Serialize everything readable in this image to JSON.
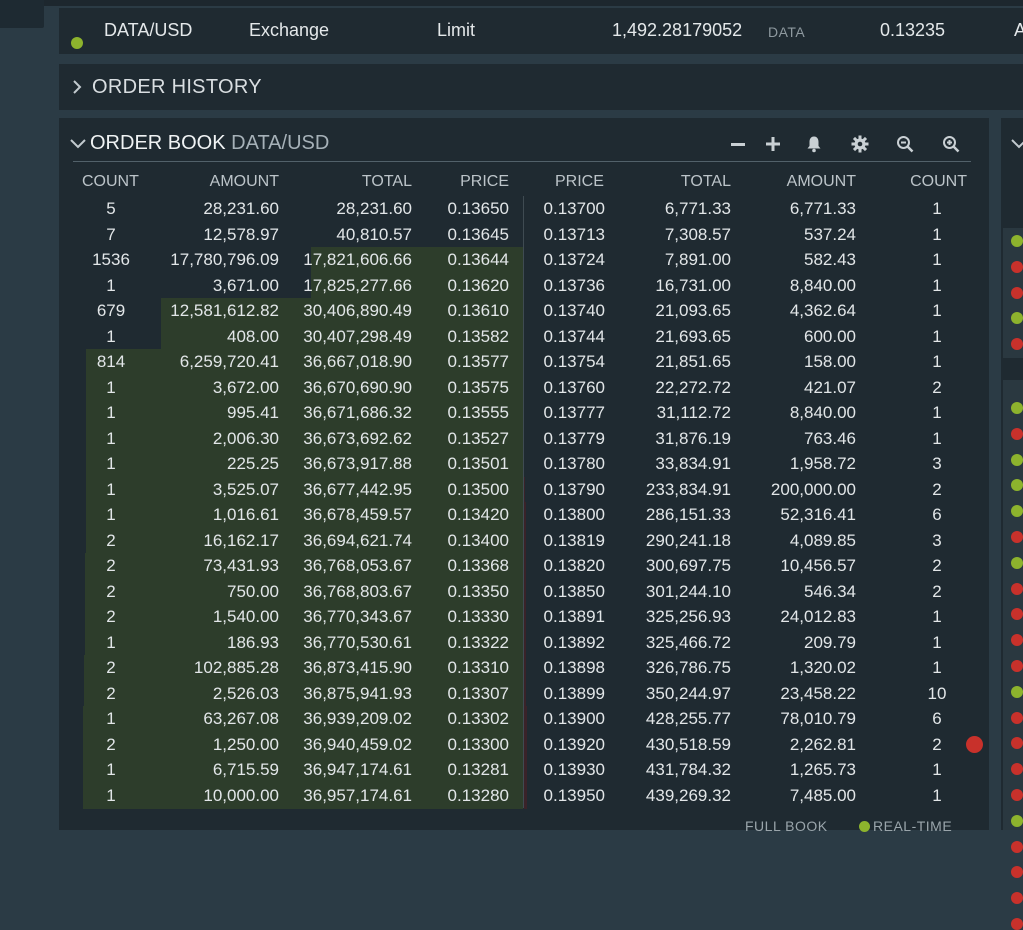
{
  "active_order": {
    "pair": "DATA/USD",
    "type": "Exchange",
    "order_type": "Limit",
    "amount": "1,492.28179052",
    "currency": "DATA",
    "price": "0.13235",
    "trailing": "A"
  },
  "order_history": {
    "title": "ORDER HISTORY"
  },
  "order_book": {
    "title": "ORDER BOOK",
    "pair": "DATA/USD",
    "tools": [
      "minus-icon",
      "plus-icon",
      "bell-icon",
      "gear-icon",
      "zoom-out-icon",
      "zoom-in-icon"
    ],
    "bid_headers": [
      "COUNT",
      "AMOUNT",
      "TOTAL",
      "PRICE"
    ],
    "ask_headers": [
      "PRICE",
      "TOTAL",
      "AMOUNT",
      "COUNT"
    ],
    "bids": [
      {
        "count": "5",
        "amount": "28,231.60",
        "total": "28,231.60",
        "price": "0.13650"
      },
      {
        "count": "7",
        "amount": "12,578.97",
        "total": "40,810.57",
        "price": "0.13645"
      },
      {
        "count": "1536",
        "amount": "17,780,796.09",
        "total": "17,821,606.66",
        "price": "0.13644"
      },
      {
        "count": "1",
        "amount": "3,671.00",
        "total": "17,825,277.66",
        "price": "0.13620"
      },
      {
        "count": "679",
        "amount": "12,581,612.82",
        "total": "30,406,890.49",
        "price": "0.13610"
      },
      {
        "count": "1",
        "amount": "408.00",
        "total": "30,407,298.49",
        "price": "0.13582"
      },
      {
        "count": "814",
        "amount": "6,259,720.41",
        "total": "36,667,018.90",
        "price": "0.13577"
      },
      {
        "count": "1",
        "amount": "3,672.00",
        "total": "36,670,690.90",
        "price": "0.13575"
      },
      {
        "count": "1",
        "amount": "995.41",
        "total": "36,671,686.32",
        "price": "0.13555"
      },
      {
        "count": "1",
        "amount": "2,006.30",
        "total": "36,673,692.62",
        "price": "0.13527"
      },
      {
        "count": "1",
        "amount": "225.25",
        "total": "36,673,917.88",
        "price": "0.13501"
      },
      {
        "count": "1",
        "amount": "3,525.07",
        "total": "36,677,442.95",
        "price": "0.13500"
      },
      {
        "count": "1",
        "amount": "1,016.61",
        "total": "36,678,459.57",
        "price": "0.13420"
      },
      {
        "count": "2",
        "amount": "16,162.17",
        "total": "36,694,621.74",
        "price": "0.13400"
      },
      {
        "count": "2",
        "amount": "73,431.93",
        "total": "36,768,053.67",
        "price": "0.13368"
      },
      {
        "count": "2",
        "amount": "750.00",
        "total": "36,768,803.67",
        "price": "0.13350"
      },
      {
        "count": "2",
        "amount": "1,540.00",
        "total": "36,770,343.67",
        "price": "0.13330"
      },
      {
        "count": "1",
        "amount": "186.93",
        "total": "36,770,530.61",
        "price": "0.13322"
      },
      {
        "count": "2",
        "amount": "102,885.28",
        "total": "36,873,415.90",
        "price": "0.13310"
      },
      {
        "count": "2",
        "amount": "2,526.03",
        "total": "36,875,941.93",
        "price": "0.13307"
      },
      {
        "count": "1",
        "amount": "63,267.08",
        "total": "36,939,209.02",
        "price": "0.13302"
      },
      {
        "count": "2",
        "amount": "1,250.00",
        "total": "36,940,459.02",
        "price": "0.13300"
      },
      {
        "count": "1",
        "amount": "6,715.59",
        "total": "36,947,174.61",
        "price": "0.13281"
      },
      {
        "count": "1",
        "amount": "10,000.00",
        "total": "36,957,174.61",
        "price": "0.13280"
      }
    ],
    "asks": [
      {
        "price": "0.13700",
        "total": "6,771.33",
        "amount": "6,771.33",
        "count": "1"
      },
      {
        "price": "0.13713",
        "total": "7,308.57",
        "amount": "537.24",
        "count": "1"
      },
      {
        "price": "0.13724",
        "total": "7,891.00",
        "amount": "582.43",
        "count": "1"
      },
      {
        "price": "0.13736",
        "total": "16,731.00",
        "amount": "8,840.00",
        "count": "1"
      },
      {
        "price": "0.13740",
        "total": "21,093.65",
        "amount": "4,362.64",
        "count": "1"
      },
      {
        "price": "0.13744",
        "total": "21,693.65",
        "amount": "600.00",
        "count": "1"
      },
      {
        "price": "0.13754",
        "total": "21,851.65",
        "amount": "158.00",
        "count": "1"
      },
      {
        "price": "0.13760",
        "total": "22,272.72",
        "amount": "421.07",
        "count": "2"
      },
      {
        "price": "0.13777",
        "total": "31,112.72",
        "amount": "8,840.00",
        "count": "1"
      },
      {
        "price": "0.13779",
        "total": "31,876.19",
        "amount": "763.46",
        "count": "1"
      },
      {
        "price": "0.13780",
        "total": "33,834.91",
        "amount": "1,958.72",
        "count": "3"
      },
      {
        "price": "0.13790",
        "total": "233,834.91",
        "amount": "200,000.00",
        "count": "2"
      },
      {
        "price": "0.13800",
        "total": "286,151.33",
        "amount": "52,316.41",
        "count": "6"
      },
      {
        "price": "0.13819",
        "total": "290,241.18",
        "amount": "4,089.85",
        "count": "3"
      },
      {
        "price": "0.13820",
        "total": "300,697.75",
        "amount": "10,456.57",
        "count": "2"
      },
      {
        "price": "0.13850",
        "total": "301,244.10",
        "amount": "546.34",
        "count": "2"
      },
      {
        "price": "0.13891",
        "total": "325,256.93",
        "amount": "24,012.83",
        "count": "1"
      },
      {
        "price": "0.13892",
        "total": "325,466.72",
        "amount": "209.79",
        "count": "1"
      },
      {
        "price": "0.13898",
        "total": "326,786.75",
        "amount": "1,320.02",
        "count": "1"
      },
      {
        "price": "0.13899",
        "total": "350,244.97",
        "amount": "23,458.22",
        "count": "10"
      },
      {
        "price": "0.13900",
        "total": "428,255.77",
        "amount": "78,010.79",
        "count": "6"
      },
      {
        "price": "0.13920",
        "total": "430,518.59",
        "amount": "2,262.81",
        "count": "2"
      },
      {
        "price": "0.13930",
        "total": "431,784.32",
        "amount": "1,265.73",
        "count": "1"
      },
      {
        "price": "0.13950",
        "total": "439,269.32",
        "amount": "7,485.00",
        "count": "1"
      }
    ],
    "footer": {
      "full_book": "FULL BOOK",
      "real_time": "REAL-TIME"
    }
  },
  "right_panel_dots": [
    "green",
    "red",
    "red",
    "green",
    "red",
    "green",
    "red",
    "green",
    "green",
    "green",
    "red",
    "green",
    "red",
    "red",
    "red",
    "red",
    "green",
    "red",
    "red",
    "red",
    "red",
    "green",
    "red",
    "red",
    "red",
    "red"
  ],
  "colors": {
    "panel": "#1f2a31",
    "background": "#2b3b45",
    "bid_depth": "#2d3d2b",
    "ask_depth": "#3a2329",
    "green": "#8db32d",
    "red": "#c8312b"
  }
}
